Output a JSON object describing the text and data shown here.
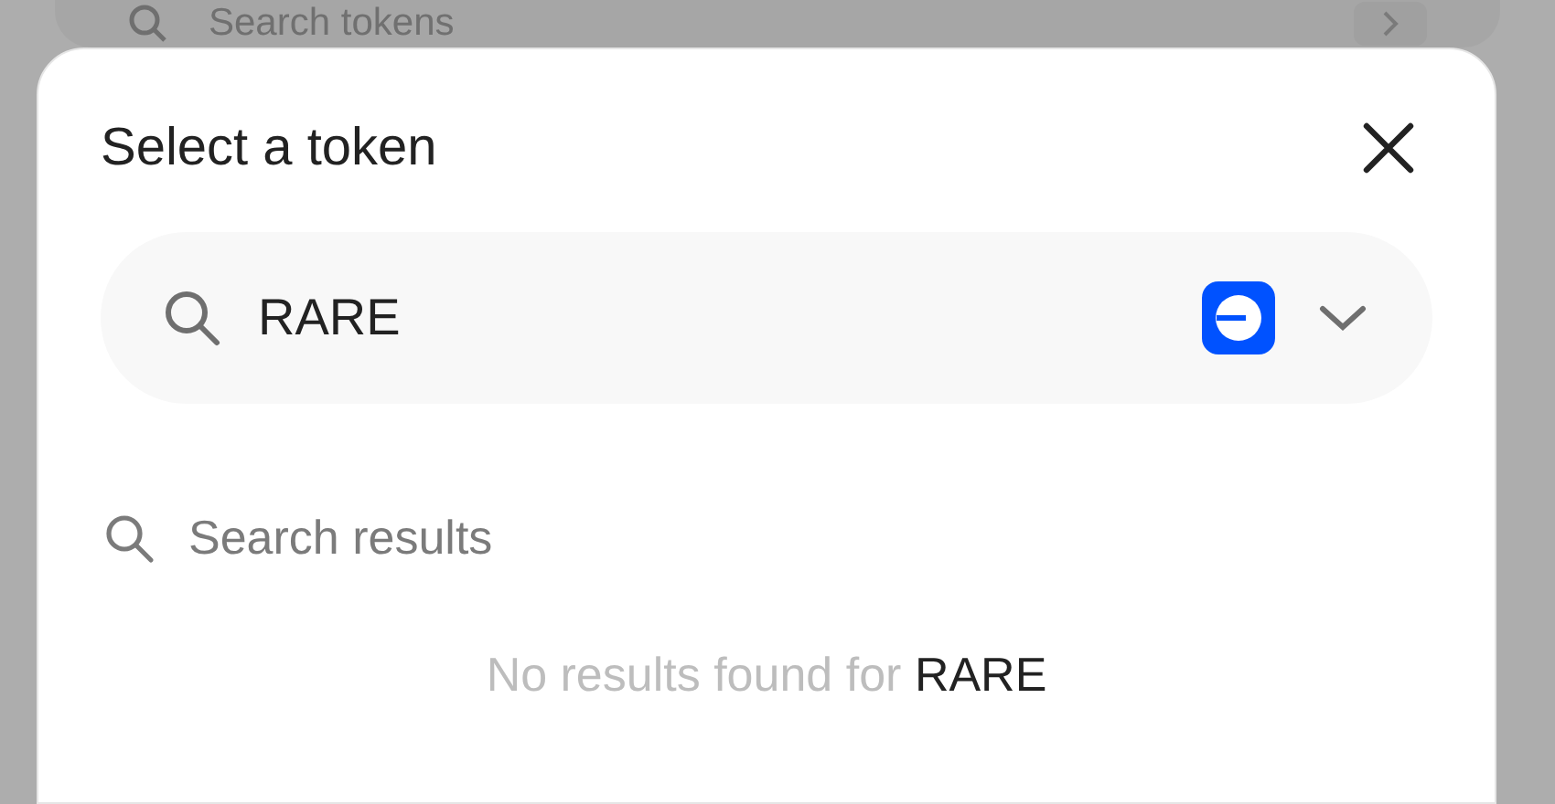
{
  "background": {
    "search": {
      "placeholder": "Search tokens"
    }
  },
  "modal": {
    "title": "Select a token",
    "search": {
      "value": "RARE"
    },
    "section": {
      "title": "Search results"
    },
    "empty_state": {
      "message": "No results found for",
      "query": "RARE"
    }
  }
}
